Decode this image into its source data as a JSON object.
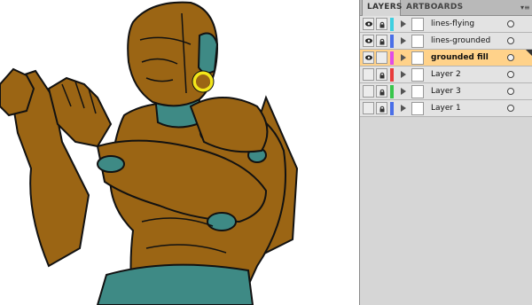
{
  "panel": {
    "tabs": [
      {
        "label": "LAYERS",
        "active": true
      },
      {
        "label": "ARTBOARDS",
        "active": false
      }
    ],
    "menu_icon": "panel-menu-icon",
    "layers": [
      {
        "name": "lines-flying",
        "color": "#3ecfe0",
        "visible": true,
        "locked": true,
        "selected": false
      },
      {
        "name": "lines-grounded",
        "color": "#4a6fe8",
        "visible": true,
        "locked": true,
        "selected": false
      },
      {
        "name": "grounded fill",
        "color": "#e04ce8",
        "visible": true,
        "locked": false,
        "selected": true
      },
      {
        "name": "Layer 2",
        "color": "#e83c3c",
        "visible": false,
        "locked": true,
        "selected": false
      },
      {
        "name": "Layer 3",
        "color": "#39c64c",
        "visible": false,
        "locked": true,
        "selected": false
      },
      {
        "name": "Layer 1",
        "color": "#4a6fe8",
        "visible": false,
        "locked": true,
        "selected": false
      }
    ]
  },
  "artwork": {
    "fill_color": "#9b6514",
    "accent_color": "#3e8a85",
    "ring_color": "#f3e61a",
    "line_color": "#111111"
  }
}
